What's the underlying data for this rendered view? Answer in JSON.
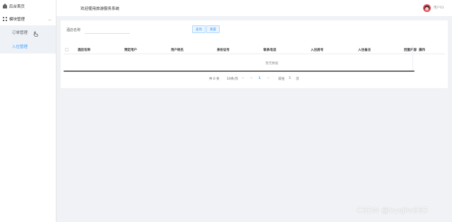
{
  "sidebar": {
    "home_label": "后台首页",
    "module_label": "模块管理",
    "items": [
      {
        "label": "订单管理"
      },
      {
        "label": "入住管理"
      }
    ]
  },
  "header": {
    "welcome": "欢迎使用旅游服务系统",
    "username": "用户01"
  },
  "search": {
    "label": "酒店名称",
    "value": "",
    "search_button": "查询",
    "reset_button": "重置"
  },
  "table": {
    "columns": [
      "酒店名称",
      "预定用户",
      "用户姓名",
      "身份证号",
      "联系电话",
      "入住房号",
      "入住备注",
      "回复内容",
      "操作"
    ],
    "rows": [],
    "empty_text": "暂无数据"
  },
  "pagination": {
    "total": "共 0 条",
    "page_size": "10条/页",
    "prev": "<",
    "current_page": "1",
    "next": ">",
    "goto_label": "前往",
    "goto_value": "1",
    "page_suffix": "页"
  },
  "watermark": "CSDN @bysjlw985",
  "colors": {
    "accent": "#409eff",
    "sidebar_bg": "#ffffff",
    "submenu_bg": "#eef1f6",
    "page_bg": "#f0f2f5"
  }
}
